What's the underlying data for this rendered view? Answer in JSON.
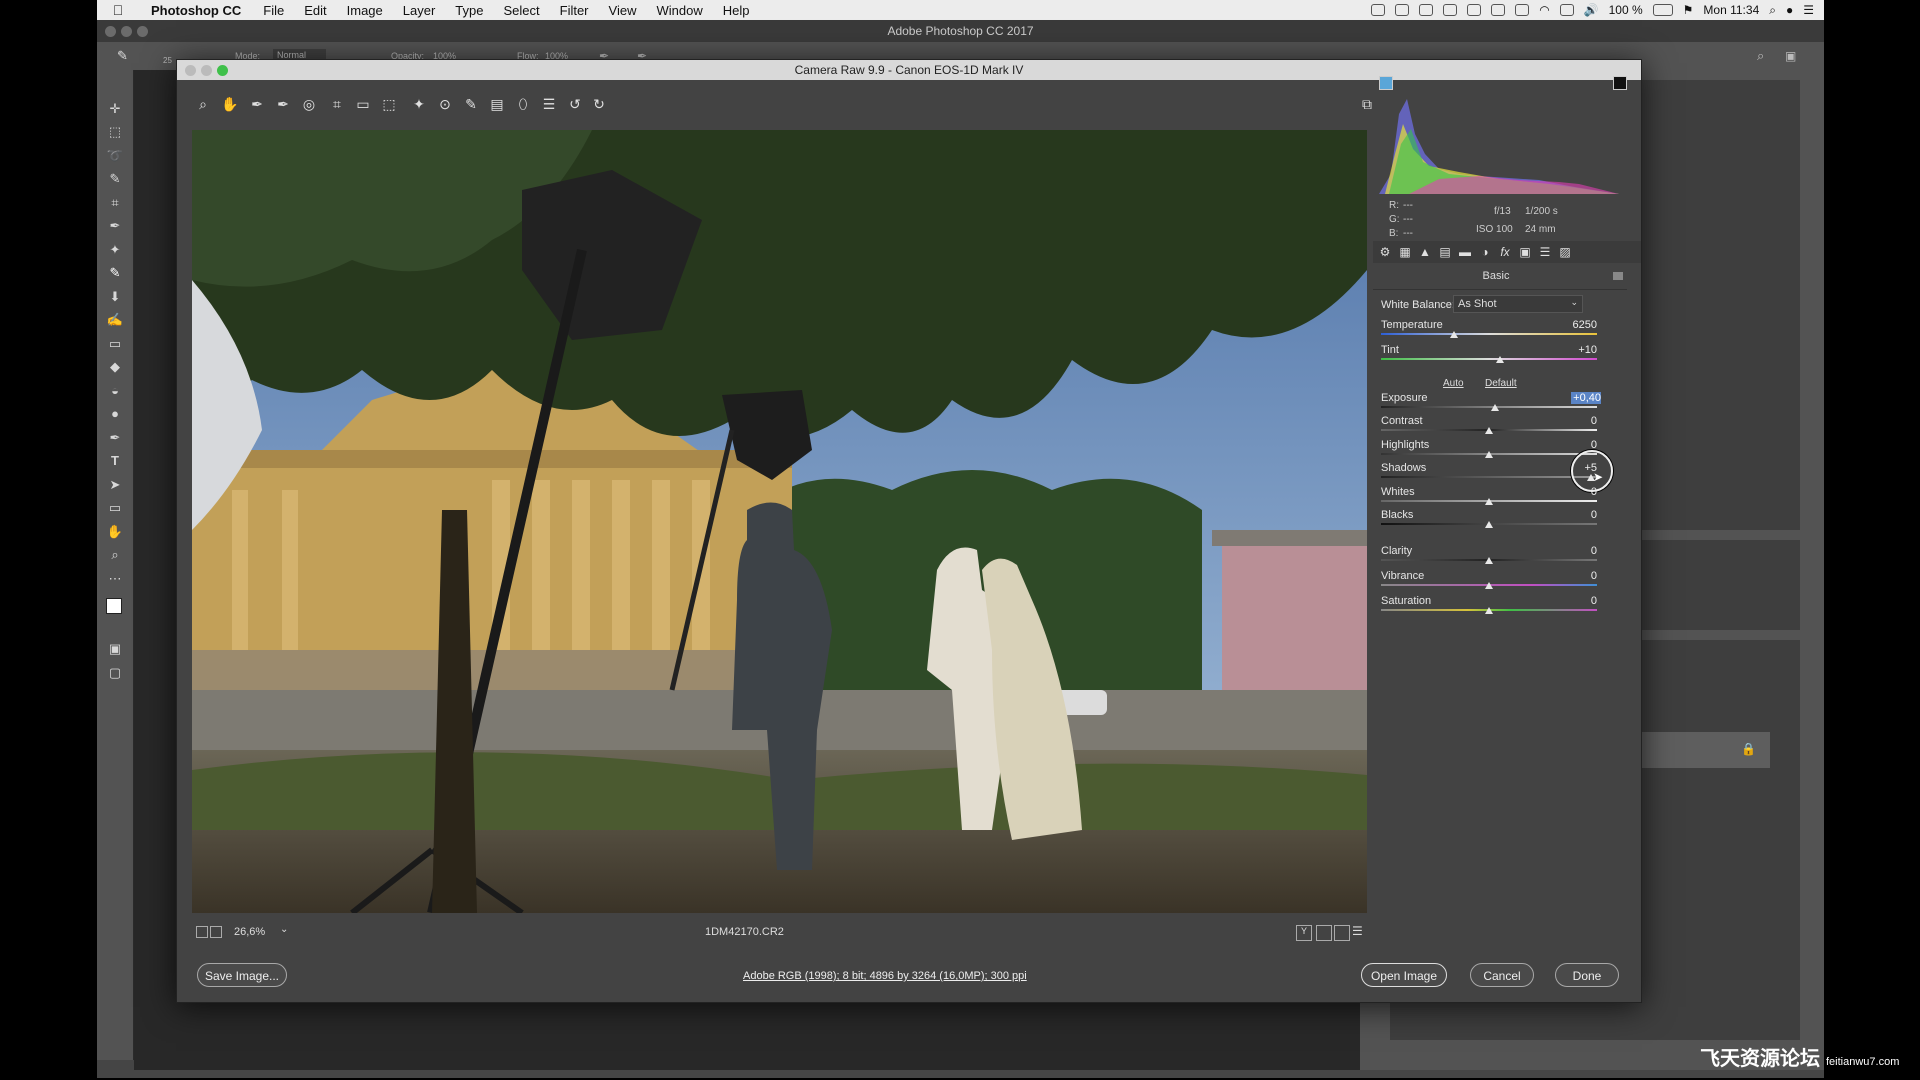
{
  "menubar": {
    "app_name": "Photoshop CC",
    "items": [
      "File",
      "Edit",
      "Image",
      "Layer",
      "Type",
      "Select",
      "Filter",
      "View",
      "Window",
      "Help"
    ],
    "battery": "100 %",
    "clock": "Mon 11:34"
  },
  "ps": {
    "window_title": "Adobe Photoshop CC 2017",
    "options": {
      "mode_label": "Mode:",
      "mode_value": "Normal",
      "opacity_label": "Opacity:",
      "opacity_value": "100%",
      "flow_label": "Flow:",
      "flow_value": "100%",
      "brush_size": "25"
    }
  },
  "acr": {
    "title": "Camera Raw 9.9  -  Canon EOS-1D Mark IV",
    "zoom": "26,6%",
    "filename": "1DM42170.CR2",
    "workflow": "Adobe RGB (1998); 8 bit; 4896 by 3264 (16,0MP); 300 ppi",
    "buttons": {
      "save": "Save Image...",
      "open": "Open Image",
      "cancel": "Cancel",
      "done": "Done"
    },
    "readout": {
      "r": "R:",
      "g": "G:",
      "b": "B:",
      "r_val": "---",
      "g_val": "---",
      "b_val": "---",
      "aperture": "f/13",
      "shutter": "1/200 s",
      "iso": "ISO 100",
      "focal": "24 mm"
    },
    "panel_title": "Basic",
    "white_balance": {
      "label": "White Balance:",
      "value": "As Shot"
    },
    "auto": "Auto",
    "default": "Default",
    "sliders": {
      "temperature": {
        "label": "Temperature",
        "value": "6250",
        "level": 0.34
      },
      "tint": {
        "label": "Tint",
        "value": "+10",
        "level": 0.55
      },
      "exposure": {
        "label": "Exposure",
        "value": "+0,40",
        "level": 0.53
      },
      "contrast": {
        "label": "Contrast",
        "value": "0",
        "level": 0.5
      },
      "highlights": {
        "label": "Highlights",
        "value": "0",
        "level": 0.5
      },
      "shadows": {
        "label": "Shadows",
        "value": "+5",
        "level": 0.97
      },
      "whites": {
        "label": "Whites",
        "value": "0",
        "level": 0.5
      },
      "blacks": {
        "label": "Blacks",
        "value": "0",
        "level": 0.5
      },
      "clarity": {
        "label": "Clarity",
        "value": "0",
        "level": 0.5
      },
      "vibrance": {
        "label": "Vibrance",
        "value": "0",
        "level": 0.5
      },
      "saturation": {
        "label": "Saturation",
        "value": "0",
        "level": 0.5
      }
    }
  },
  "watermark": {
    "text": "飞天资源论坛",
    "url": "feitianwu7.com"
  }
}
